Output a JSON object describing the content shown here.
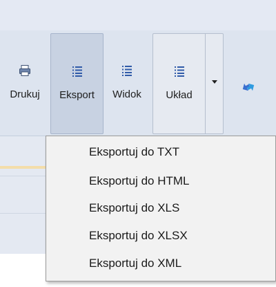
{
  "ribbon": {
    "buttons": [
      {
        "label": "Drukuj",
        "icon": "printer-icon"
      },
      {
        "label": "Eksport",
        "icon": "list-icon"
      },
      {
        "label": "Widok",
        "icon": "list-icon"
      },
      {
        "label": "Układ",
        "icon": "list-icon"
      }
    ],
    "refresh_icon": "refresh-arrows-icon",
    "dropdown_icon": "chevron-down-icon"
  },
  "export_menu": {
    "items": [
      "Eksportuj do TXT",
      "Eksportuj do HTML",
      "Eksportuj do XLS",
      "Eksportuj do XLSX",
      "Eksportuj do XML"
    ]
  },
  "colors": {
    "ribbon_bg": "#dde4ef",
    "pressed_bg": "#c8d2e2",
    "icon_blue": "#2f5aa8",
    "menu_bg": "#f2f2f2"
  }
}
